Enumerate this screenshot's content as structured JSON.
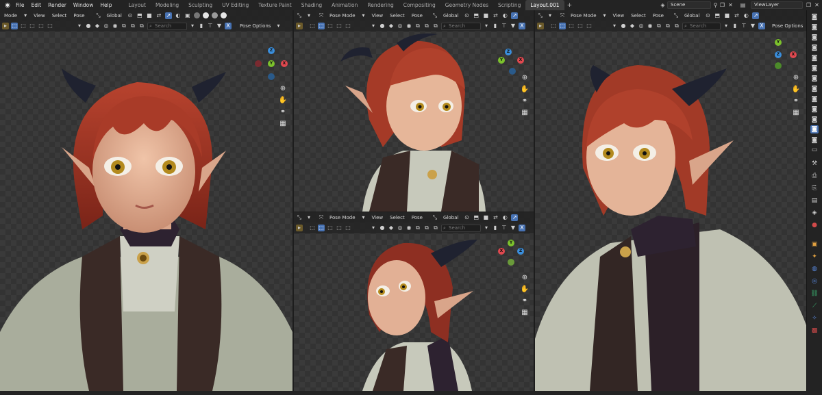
{
  "topbar": {
    "menus": [
      "File",
      "Edit",
      "Render",
      "Window",
      "Help"
    ],
    "workspaces": [
      "Layout",
      "Modeling",
      "Sculpting",
      "UV Editing",
      "Texture Paint",
      "Shading",
      "Animation",
      "Rendering",
      "Compositing",
      "Geometry Nodes",
      "Scripting",
      "Layout.001"
    ],
    "active_workspace": "Layout.001",
    "add_tab": "+",
    "scene": "Scene",
    "view_layer": "ViewLayer"
  },
  "viewports": {
    "left": {
      "mode": "Mode",
      "view": "View",
      "select": "Select",
      "pose": "Pose",
      "orientation": "Global",
      "search_placeholder": "Search",
      "pose_options": "Pose Options"
    },
    "top_mid": {
      "mode": "Pose Mode",
      "view": "View",
      "select": "Select",
      "pose": "Pose",
      "orientation": "Global",
      "search_placeholder": "Search"
    },
    "bottom_mid": {
      "mode": "Pose Mode",
      "view": "View",
      "select": "Select",
      "pose": "Pose",
      "orientation": "Global",
      "search_placeholder": "Search"
    },
    "right": {
      "mode": "Pose Mode",
      "view": "View",
      "select": "Select",
      "pose": "Pose",
      "orientation": "Global",
      "search_placeholder": "Search",
      "pose_options": "Pose Options"
    }
  },
  "gizmo": {
    "z": "Z",
    "y": "Y",
    "x": "X"
  },
  "colors": {
    "accent": "#4772b3",
    "x_axis": "#e0484f",
    "y_axis": "#7cc12c",
    "z_axis": "#3a8edc"
  }
}
